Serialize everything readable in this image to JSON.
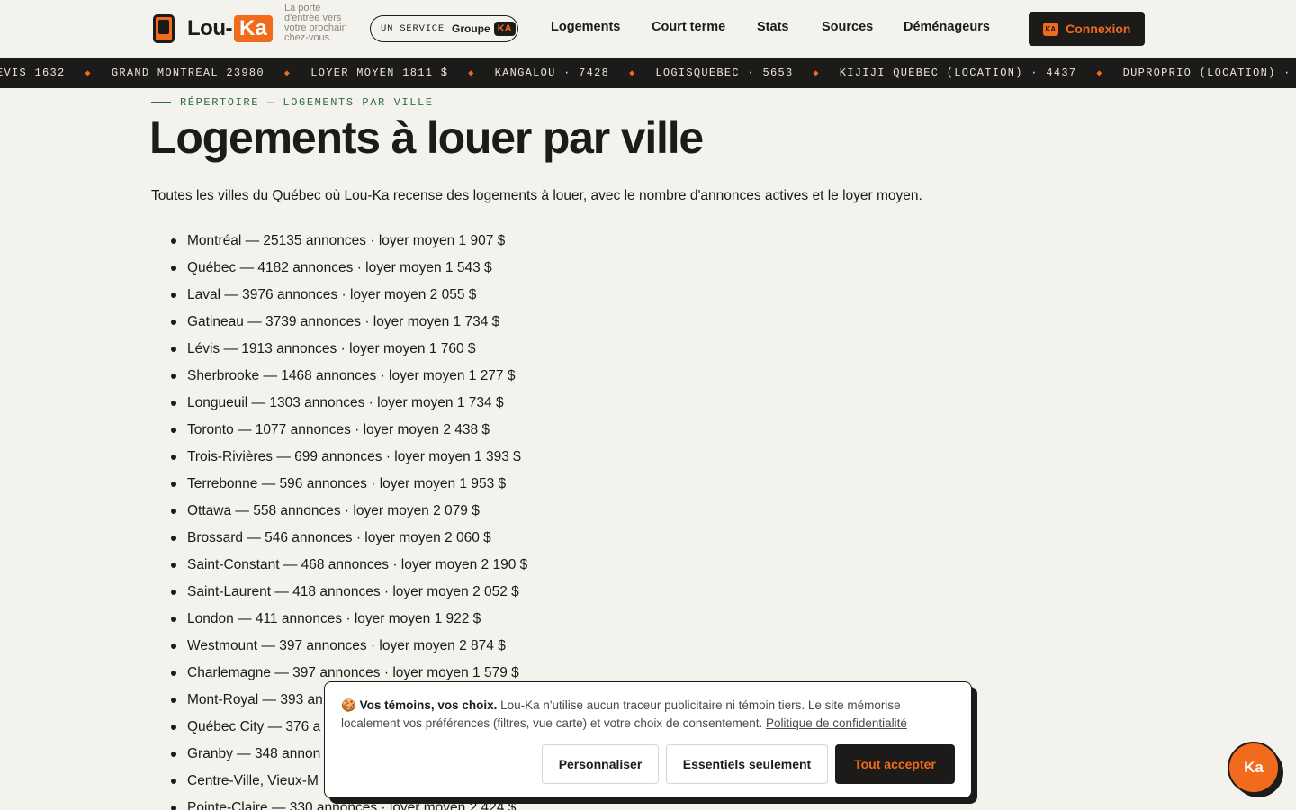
{
  "header": {
    "logo_lou": "Lou-",
    "logo_ka": "Ka",
    "tagline": "La porte d'entrée vers votre prochain chez-vous.",
    "service_label": "UN SERVICE",
    "service_group": "Groupe",
    "service_badge": "KA",
    "nav": [
      "Logements",
      "Court terme",
      "Stats",
      "Sources",
      "Déménageurs"
    ],
    "login_badge": "KA",
    "login_label": "Connexion"
  },
  "ticker": [
    "ÉVIS 1632",
    "GRAND MONTRÉAL 23980",
    "LOYER MOYEN 1811 $",
    "KANGALOU · 7428",
    "LOGISQUÉBEC · 5653",
    "KIJIJI QUÉBEC (LOCATION) · 4437",
    "DUPROPRIO (LOCATION) · 3592"
  ],
  "main": {
    "eyebrow": "RÉPERTOIRE — LOGEMENTS PAR VILLE",
    "title": "Logements à louer par ville",
    "intro": "Toutes les villes du Québec où Lou-Ka recense des logements à louer, avec le nombre d'annonces actives et le loyer moyen.",
    "cities": [
      "Montréal — 25135 annonces · loyer moyen 1 907 $",
      "Québec — 4182 annonces · loyer moyen 1 543 $",
      "Laval — 3976 annonces · loyer moyen 2 055 $",
      "Gatineau — 3739 annonces · loyer moyen 1 734 $",
      "Lévis — 1913 annonces · loyer moyen 1 760 $",
      "Sherbrooke — 1468 annonces · loyer moyen 1 277 $",
      "Longueuil — 1303 annonces · loyer moyen 1 734 $",
      "Toronto — 1077 annonces · loyer moyen 2 438 $",
      "Trois-Rivières — 699 annonces · loyer moyen 1 393 $",
      "Terrebonne — 596 annonces · loyer moyen 1 953 $",
      "Ottawa — 558 annonces · loyer moyen 2 079 $",
      "Brossard — 546 annonces · loyer moyen 2 060 $",
      "Saint-Constant — 468 annonces · loyer moyen 2 190 $",
      "Saint-Laurent — 418 annonces · loyer moyen 2 052 $",
      "London — 411 annonces · loyer moyen 1 922 $",
      "Westmount — 397 annonces · loyer moyen 2 874 $",
      "Charlemagne — 397 annonces · loyer moyen 1 579 $",
      "Mont-Royal — 393 an",
      "Québec City — 376 a",
      "Granby — 348 annon",
      "Centre-Ville, Vieux-M",
      "Pointe-Claire — 330 annonces · loyer moyen 2 424 $"
    ]
  },
  "cookie": {
    "emoji": "🍪",
    "title": "Vos témoins, vos choix.",
    "body": "Lou-Ka n'utilise aucun traceur publicitaire ni témoin tiers. Le site mémorise localement vos préférences (filtres, vue carte) et votre choix de consentement.",
    "link": "Politique de confidentialité",
    "btn_customize": "Personnaliser",
    "btn_essentials": "Essentiels seulement",
    "btn_accept": "Tout accepter"
  },
  "fab": {
    "label": "Ka"
  },
  "colors": {
    "accent": "#f26a1b",
    "dark": "#1c1b19",
    "background": "#f4f2ed",
    "eyebrow_green": "#2f6b4a"
  }
}
